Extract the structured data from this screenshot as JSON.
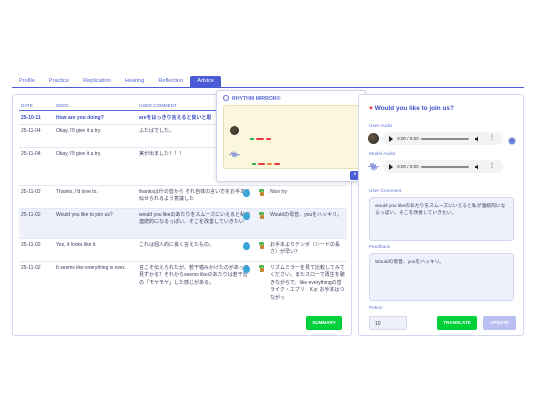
{
  "tabs": [
    "Profile",
    "Practice",
    "Replication",
    "Hearing",
    "Reflection",
    "Advice"
  ],
  "active_tab": "Advice",
  "table": {
    "headers": {
      "date": "DATE",
      "seed": "SEED",
      "user_comment": "USER COMMENT"
    },
    "rows": [
      {
        "date": "25-10-11",
        "seed": "How are you doing?",
        "user": "areをはっきり言えると良いと思",
        "fb": ""
      },
      {
        "date": "25-11-04",
        "seed": "Okay, I'll give it a try.",
        "user": "ふたばでした。",
        "fb": ""
      },
      {
        "date": "25-11-04",
        "seed": "Okay, I'll give it a try.",
        "user": "実が出ました！！！",
        "fb": ""
      },
      {
        "date": "25-11-02",
        "seed": "Thanks, I'd love to.",
        "user": "thanksは什の音から それ自体の言い方をお手本に似せられるよう意識した",
        "fb": "Nice try"
      },
      {
        "date": "25-11-02",
        "seed": "Would you like to join us?",
        "user": "would you likeのあたりをスムーズにいえると私が連続的になるっぽい、そこを改善していきたい",
        "fb": "Wouldの母音、youをハッキリ。"
      },
      {
        "date": "25-11-02",
        "seed": "Yes, it looks like it.",
        "user": "これは個人的に良く言えたもの。",
        "fb": "お手本よりテンポ（シードの長さ）が早い？"
      },
      {
        "date": "25-11-02",
        "seed": "It seems like everything is over.",
        "user": "言こそ伝えられたが、若干噛みかけたのがあって見ずかる？それからseems likeのあたりは若干音の「モヤモヤ」した感じがある。",
        "fb": "リズムミラーを見て比較してみてください。またスローで再生を聴きながらで、like everythingの音ライク・エブリ　Kぉ お手本はつながっ"
      }
    ]
  },
  "popup": {
    "title": "RHYTHM MIRROR®",
    "close": "×"
  },
  "summary_button": "SUMMARY",
  "right": {
    "title": "Would you like to join us?",
    "user_audio_label": "User Audio",
    "model_audio_label": "Model Audio",
    "player_time": "0:00 / 0:00",
    "user_comment_label": "User Comment",
    "user_comment": "would you likeのあたりをスムーズにいえると私が連続的になるっぽい、そこを改善していきたい。",
    "feedback_label": "Feedback",
    "feedback": "Wouldの母音、youをハッキリ。",
    "potion_label": "Potion",
    "potion_value": "10",
    "translate_button": "TRANSLATE",
    "update_button": "UPDATE"
  },
  "colors": {
    "accent": "#4a5bd6",
    "success": "#00d13b",
    "link": "#3b4ec4"
  }
}
